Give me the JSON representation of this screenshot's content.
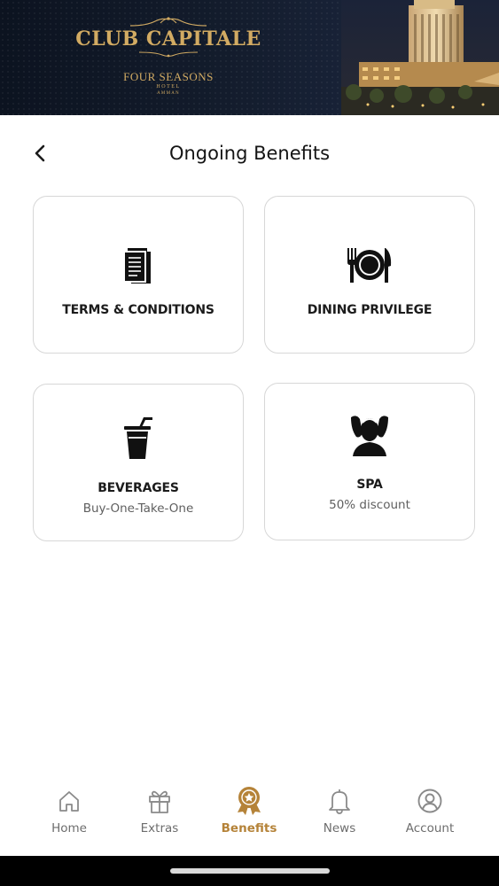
{
  "header": {
    "brand_title": "CLUB CAPITALE",
    "hotel_name": "FOUR SEASONS",
    "hotel_word": "HOTEL",
    "city": "AMMAN"
  },
  "page": {
    "title": "Ongoing Benefits",
    "back_icon": "chevron-left-icon"
  },
  "cards": [
    {
      "icon": "document-icon",
      "title": "TERMS & CONDITIONS",
      "subtitle": ""
    },
    {
      "icon": "dining-icon",
      "title": "DINING PRIVILEGE",
      "subtitle": ""
    },
    {
      "icon": "beverage-icon",
      "title": "BEVERAGES",
      "subtitle": "Buy-One-Take-One"
    },
    {
      "icon": "spa-icon",
      "title": "SPA",
      "subtitle": "50% discount"
    }
  ],
  "nav": {
    "items": [
      {
        "icon": "home-icon",
        "label": "Home",
        "active": false
      },
      {
        "icon": "gift-icon",
        "label": "Extras",
        "active": false
      },
      {
        "icon": "award-icon",
        "label": "Benefits",
        "active": true
      },
      {
        "icon": "bell-icon",
        "label": "News",
        "active": false
      },
      {
        "icon": "account-icon",
        "label": "Account",
        "active": false
      }
    ]
  },
  "colors": {
    "accent": "#b58339",
    "brand_gold": "#d2ab63",
    "banner_bg": "#131c2c",
    "inactive_nav": "#6d6d6d"
  }
}
